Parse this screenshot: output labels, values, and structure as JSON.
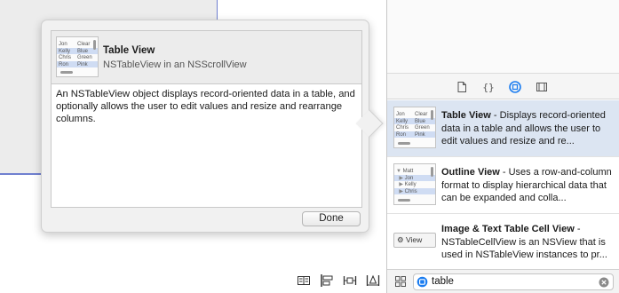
{
  "popover": {
    "title": "Table View",
    "subtitle": "NSTableView in an NSScrollView",
    "description": "An NSTableView object displays record-oriented data in a table, and optionally allows the user to edit values and resize and rearrange columns.",
    "done_label": "Done",
    "thumbnail": {
      "rows": [
        [
          "Jon",
          "Clear"
        ],
        [
          "Kelly",
          "Blue"
        ],
        [
          "Chris",
          "Green"
        ],
        [
          "Ron",
          "Pink"
        ]
      ],
      "selected_row": 1
    }
  },
  "inspector_tabs": [
    {
      "icon": "file-icon"
    },
    {
      "icon": "braces-icon"
    },
    {
      "icon": "object-library-icon",
      "active": true
    },
    {
      "icon": "media-library-icon"
    }
  ],
  "library": {
    "items": [
      {
        "title": "Table View",
        "desc": " - Displays record-oriented data in a table and allows the user to edit values and resize and re...",
        "selected": true
      },
      {
        "title": "Outline View",
        "desc": " - Uses a row-and-column format to display hierarchical data that can be expanded and colla...",
        "thumb_rows": [
          "Matt",
          "Jon",
          "Kelly",
          "Chris"
        ]
      },
      {
        "title": "Image & Text Table Cell View",
        "desc": " - NSTableCellView is an NSView that is used in NSTableView instances to pr...",
        "chip_label": "View"
      }
    ]
  },
  "filter": {
    "search_value": "table"
  },
  "colors": {
    "accent": "#1a7cf0",
    "selection": "#dce5f2"
  }
}
